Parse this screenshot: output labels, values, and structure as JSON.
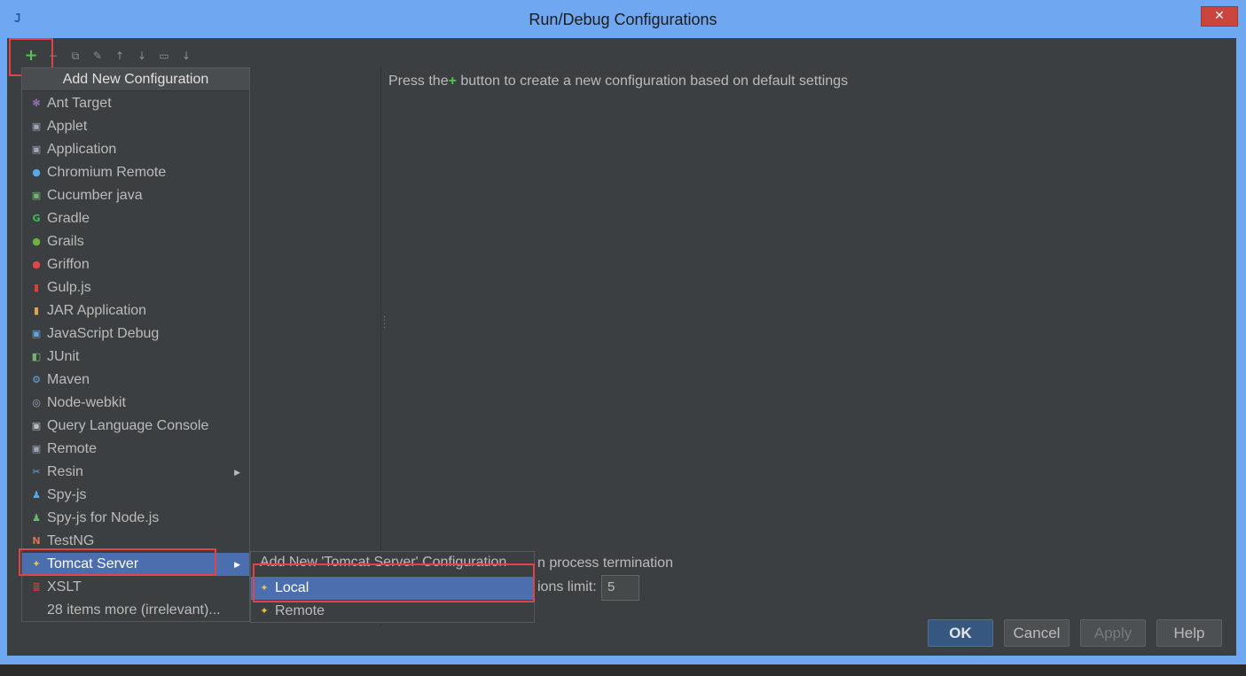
{
  "window": {
    "title": "Run/Debug Configurations",
    "logo_text": "J",
    "close_glyph": "✕"
  },
  "toolbar": {
    "add_glyph": "+",
    "remove_glyph": "−",
    "copy_glyph": "⧉",
    "edit_defaults_glyph": "✎",
    "move_up_glyph": "↑",
    "move_down_glyph": "↓",
    "folder_glyph": "▭",
    "sort_glyph": "↓"
  },
  "main": {
    "hint_prefix": "Press the",
    "hint_plus": "+",
    "hint_suffix": " button to create a new configuration based on default settings",
    "option_terminate_suffix": "n process termination",
    "option_limit_suffix": "ions limit:",
    "limit_value": "5"
  },
  "buttons": {
    "ok": "OK",
    "cancel": "Cancel",
    "apply": "Apply",
    "help": "Help"
  },
  "popup": {
    "header": "Add New Configuration",
    "items": [
      {
        "label": "Ant Target",
        "icon": "ant-icon",
        "glyph": "✻",
        "color": "#b07fd0"
      },
      {
        "label": "Applet",
        "icon": "applet-icon",
        "glyph": "▣",
        "color": "#9aa6b4"
      },
      {
        "label": "Application",
        "icon": "application-icon",
        "glyph": "▣",
        "color": "#9aa6b4"
      },
      {
        "label": "Chromium Remote",
        "icon": "chromium-icon",
        "glyph": "●",
        "color": "#5aa6e6"
      },
      {
        "label": "Cucumber java",
        "icon": "cucumber-icon",
        "glyph": "▣",
        "color": "#6fb56f"
      },
      {
        "label": "Gradle",
        "icon": "gradle-icon",
        "glyph": "G",
        "color": "#3fb95a"
      },
      {
        "label": "Grails",
        "icon": "grails-icon",
        "glyph": "●",
        "color": "#6cb33f"
      },
      {
        "label": "Griffon",
        "icon": "griffon-icon",
        "glyph": "●",
        "color": "#e04848"
      },
      {
        "label": "Gulp.js",
        "icon": "gulp-icon",
        "glyph": "▮",
        "color": "#d9413a"
      },
      {
        "label": "JAR Application",
        "icon": "jar-icon",
        "glyph": "▮",
        "color": "#d9a64e"
      },
      {
        "label": "JavaScript Debug",
        "icon": "js-debug-icon",
        "glyph": "▣",
        "color": "#5aa6e6"
      },
      {
        "label": "JUnit",
        "icon": "junit-icon",
        "glyph": "◧",
        "color": "#6fb56f"
      },
      {
        "label": "Maven",
        "icon": "maven-icon",
        "glyph": "⚙",
        "color": "#6aa6d6"
      },
      {
        "label": "Node-webkit",
        "icon": "node-webkit-icon",
        "glyph": "◎",
        "color": "#9aa6b4"
      },
      {
        "label": "Query Language Console",
        "icon": "query-console-icon",
        "glyph": "▣",
        "color": "#bbbbbb"
      },
      {
        "label": "Remote",
        "icon": "remote-icon",
        "glyph": "▣",
        "color": "#9aa6b4"
      },
      {
        "label": "Resin",
        "icon": "resin-icon",
        "glyph": "✂",
        "color": "#6aa6d6",
        "has_submenu": true
      },
      {
        "label": "Spy-js",
        "icon": "spy-js-icon",
        "glyph": "♟",
        "color": "#5aa6e6"
      },
      {
        "label": "Spy-js for Node.js",
        "icon": "spy-js-node-icon",
        "glyph": "♟",
        "color": "#6fb56f"
      },
      {
        "label": "TestNG",
        "icon": "testng-icon",
        "glyph": "N",
        "color": "#d9734e"
      },
      {
        "label": "Tomcat Server",
        "icon": "tomcat-icon",
        "glyph": "✦",
        "color": "#e6c34a",
        "has_submenu": true,
        "selected": true
      },
      {
        "label": "XSLT",
        "icon": "xslt-icon",
        "glyph": "≣",
        "color": "#d9413a"
      },
      {
        "label": "28 items more (irrelevant)...",
        "icon": "",
        "glyph": "",
        "color": "#bbbbbb"
      }
    ],
    "submenu_arrow": "▶"
  },
  "subpopup": {
    "header": "Add New 'Tomcat Server' Configuration",
    "items": [
      {
        "label": "Local",
        "icon": "tomcat-local-icon",
        "glyph": "✦",
        "color": "#e6c34a",
        "selected": true
      },
      {
        "label": "Remote",
        "icon": "tomcat-remote-icon",
        "glyph": "✦",
        "color": "#e6c34a"
      }
    ]
  },
  "colors": {
    "accent_selection": "#4b6eaf",
    "highlight_box": "#e24346",
    "add_green": "#4fc44f",
    "background": "#3c3f41"
  }
}
